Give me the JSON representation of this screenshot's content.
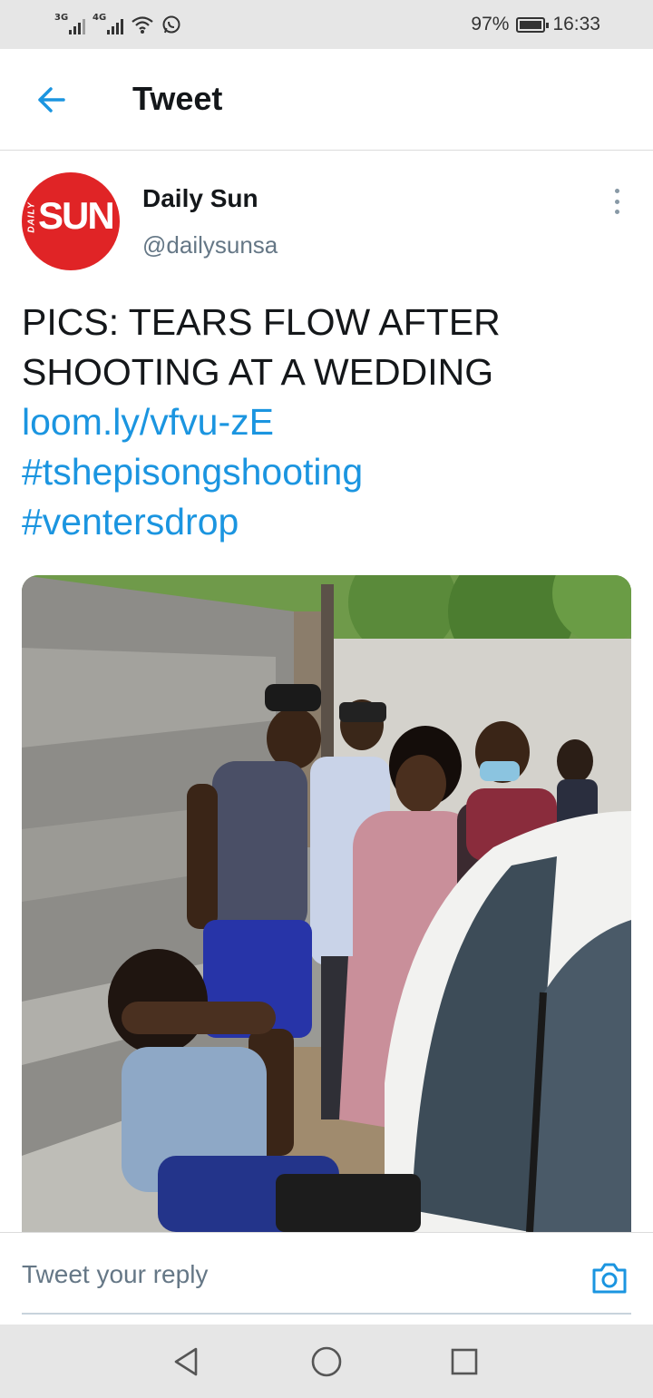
{
  "status_bar": {
    "signal1_label": "3G",
    "signal2_label": "4G",
    "battery": "97%",
    "time": "16:33",
    "icons": [
      "signal-icon",
      "signal-icon",
      "wifi-icon",
      "whatsapp-icon",
      "battery-icon"
    ]
  },
  "header": {
    "title": "Tweet",
    "back_icon": "arrow-left-icon"
  },
  "tweet": {
    "avatar_logo": "SUN",
    "avatar_logo_side": "DAILY",
    "author_name": "Daily Sun",
    "author_handle": "@dailysunsa",
    "text_line1": "PICS: TEARS FLOW AFTER",
    "text_line2": "SHOOTING AT A WEDDING",
    "link": "loom.ly/vfvu-zE",
    "hashtag1": "#tshepisongshooting",
    "hashtag2": "#ventersdrop",
    "more_icon": "more-vertical-icon"
  },
  "reply": {
    "placeholder": "Tweet your reply",
    "camera_icon": "camera-icon"
  },
  "nav": {
    "icons": [
      "back-triangle-icon",
      "home-circle-icon",
      "recents-square-icon"
    ]
  },
  "colors": {
    "accent": "#1b95e0",
    "avatar_red": "#e02426",
    "muted": "#657786"
  }
}
